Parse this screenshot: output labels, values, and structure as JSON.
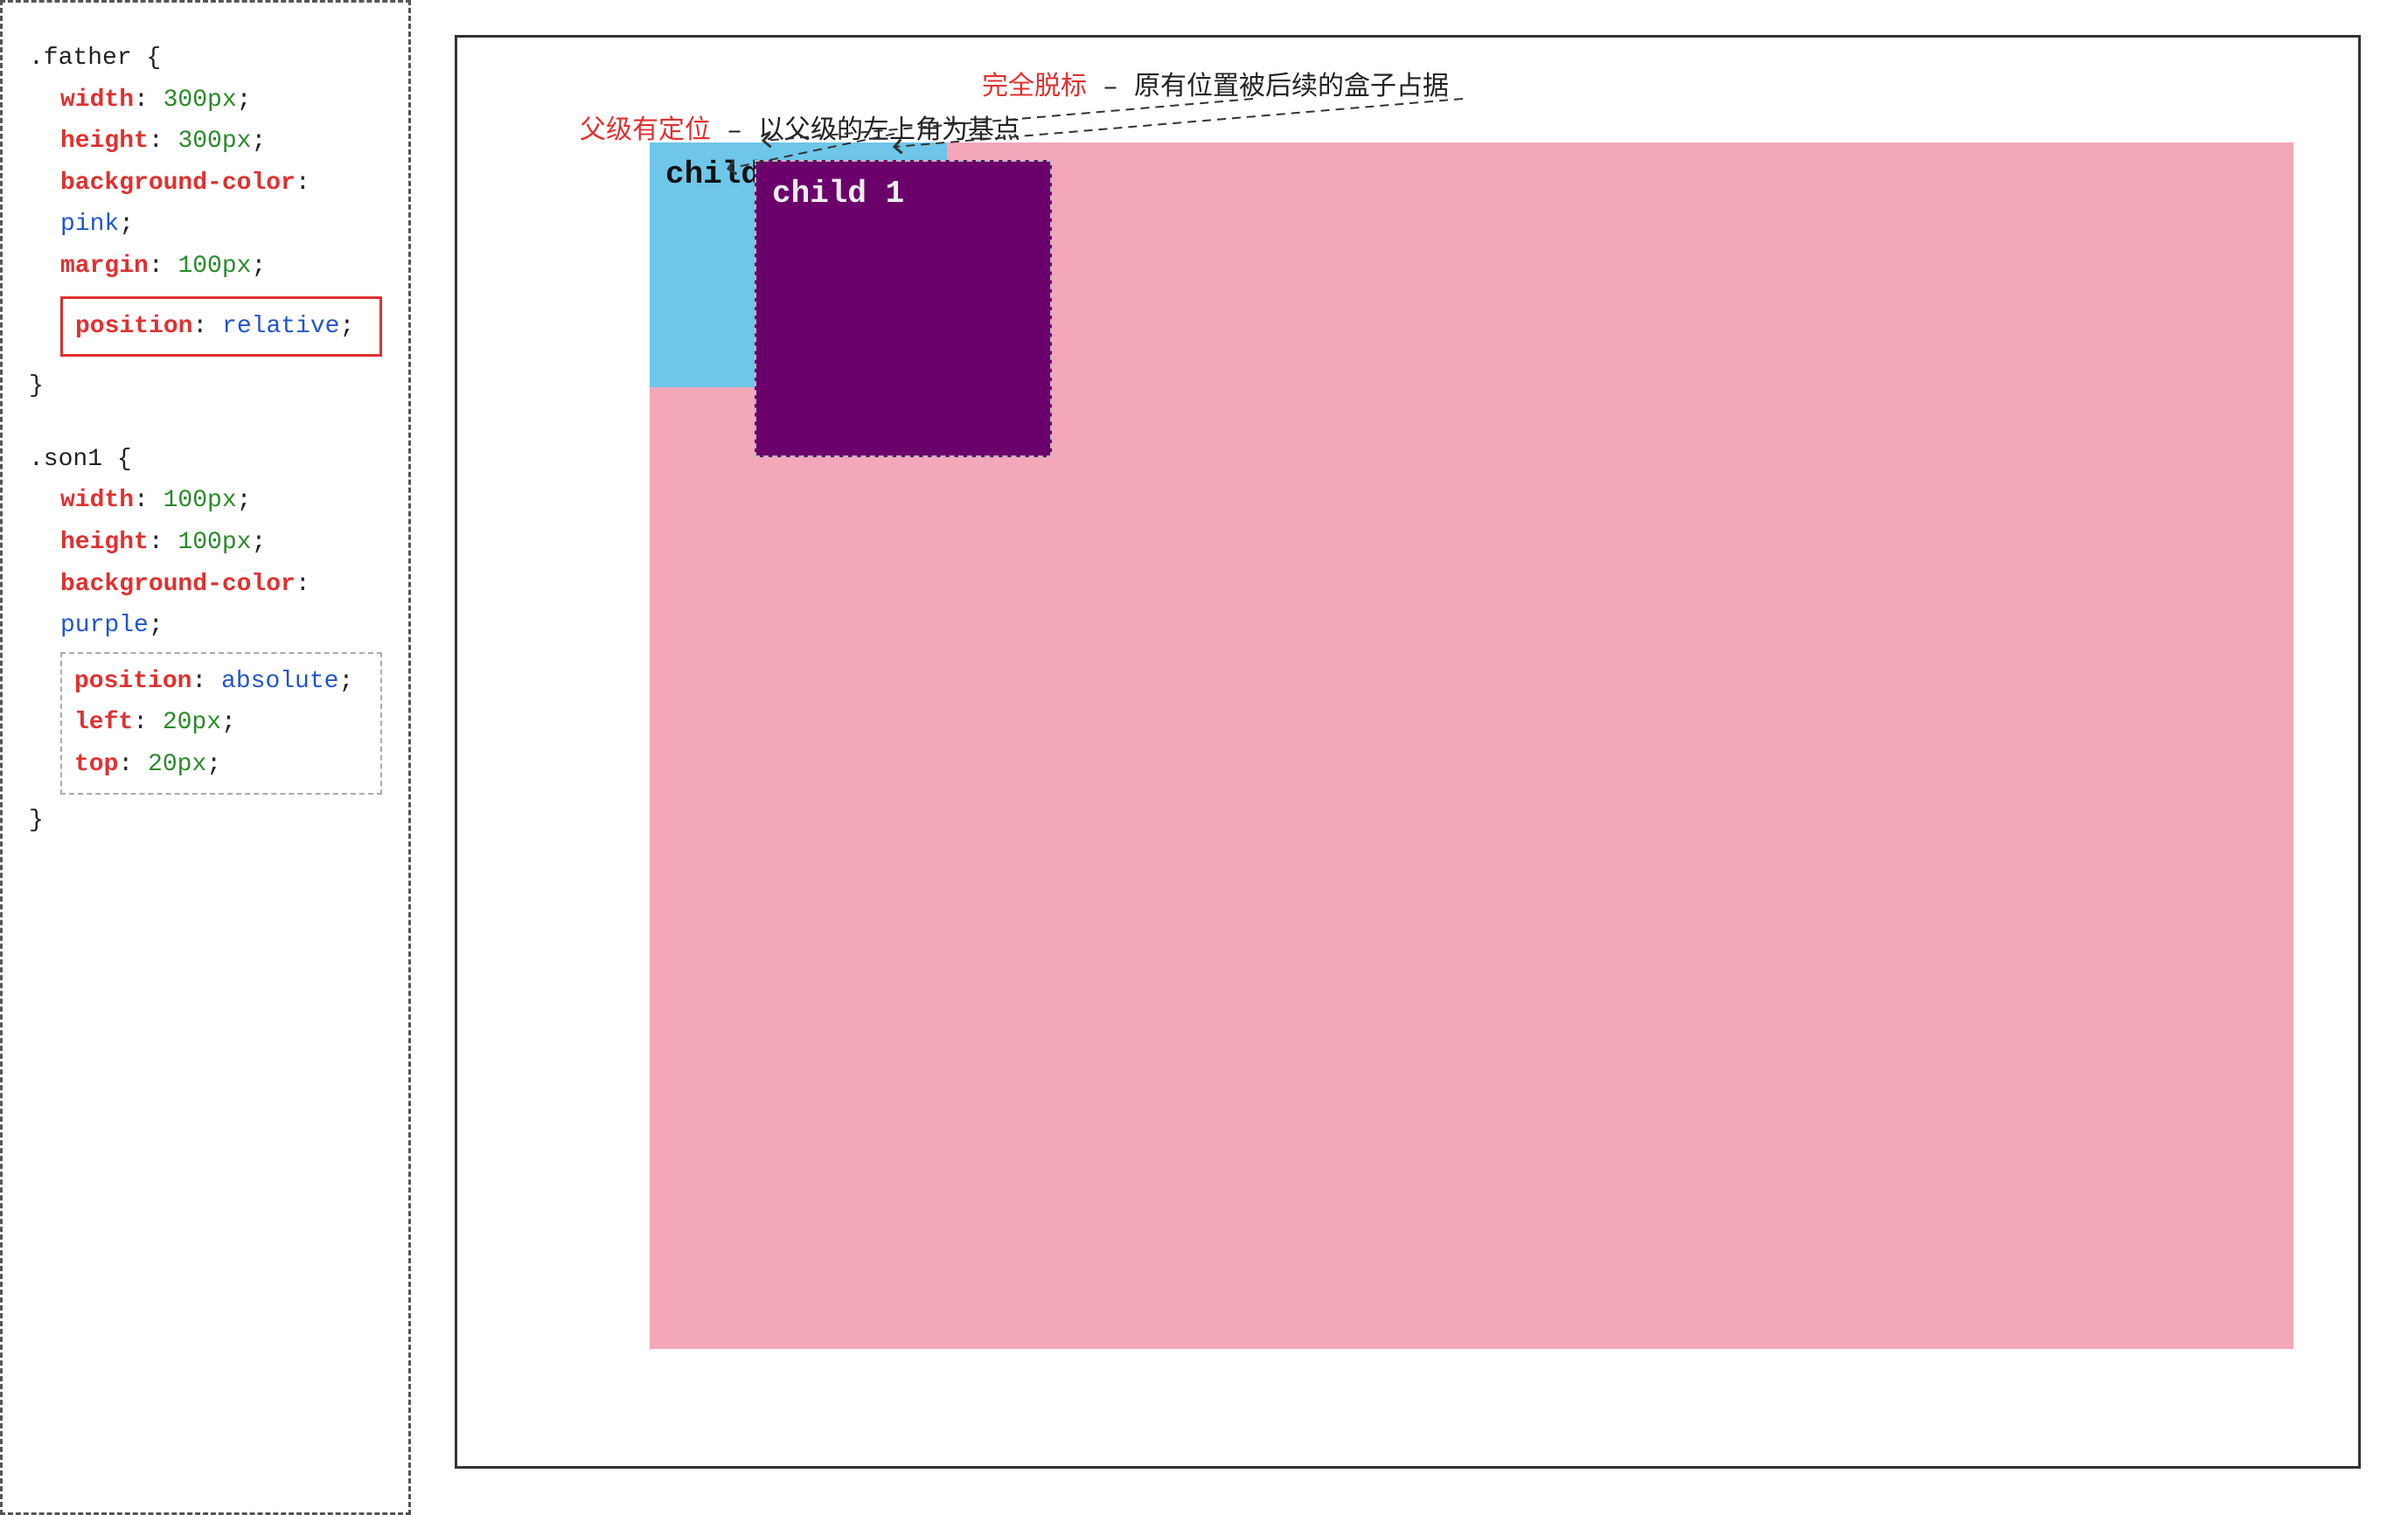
{
  "leftPanel": {
    "father_selector": ".father {",
    "father_props": [
      {
        "property": "width",
        "colon": ":",
        "value": "300px",
        "propColor": "red",
        "valueColor": "green"
      },
      {
        "property": "height",
        "colon": ":",
        "value": "300px",
        "propColor": "red",
        "valueColor": "green"
      },
      {
        "property": "background-color",
        "colon": ":",
        "value": "pink",
        "propColor": "red",
        "valueColor": "blue"
      },
      {
        "property": "margin",
        "colon": ":",
        "value": "100px",
        "propColor": "red",
        "valueColor": "green"
      }
    ],
    "father_highlight": {
      "property": "position",
      "colon": ":",
      "value": "relative",
      "propColor": "red",
      "valueColor": "blue"
    },
    "father_close": "}",
    "son1_selector": ".son1 {",
    "son1_props": [
      {
        "property": "width",
        "colon": ":",
        "value": "100px",
        "propColor": "red",
        "valueColor": "green"
      },
      {
        "property": "height",
        "colon": ":",
        "value": "100px",
        "propColor": "red",
        "valueColor": "green"
      },
      {
        "property": "background-color",
        "colon": ":",
        "value": "purple",
        "propColor": "red",
        "valueColor": "blue"
      }
    ],
    "son1_dashed": [
      {
        "property": "position",
        "colon": ":",
        "value": "absolute",
        "propColor": "red",
        "valueColor": "blue"
      },
      {
        "property": "left",
        "colon": ":",
        "value": "20px",
        "propColor": "red",
        "valueColor": "green"
      },
      {
        "property": "top",
        "colon": ":",
        "value": "20px",
        "propColor": "red",
        "valueColor": "green"
      }
    ],
    "son1_close": "}"
  },
  "rightPanel": {
    "topAnnotation": {
      "red_part": "完全脱标",
      "black_part": " – 原有位置被后续的盒子占据"
    },
    "leftAnnotation": {
      "red_part": "父级有定位",
      "black_part": " – 以父级的左上角为基点"
    },
    "child1_label": "child 1",
    "child2_label": "child 2"
  }
}
